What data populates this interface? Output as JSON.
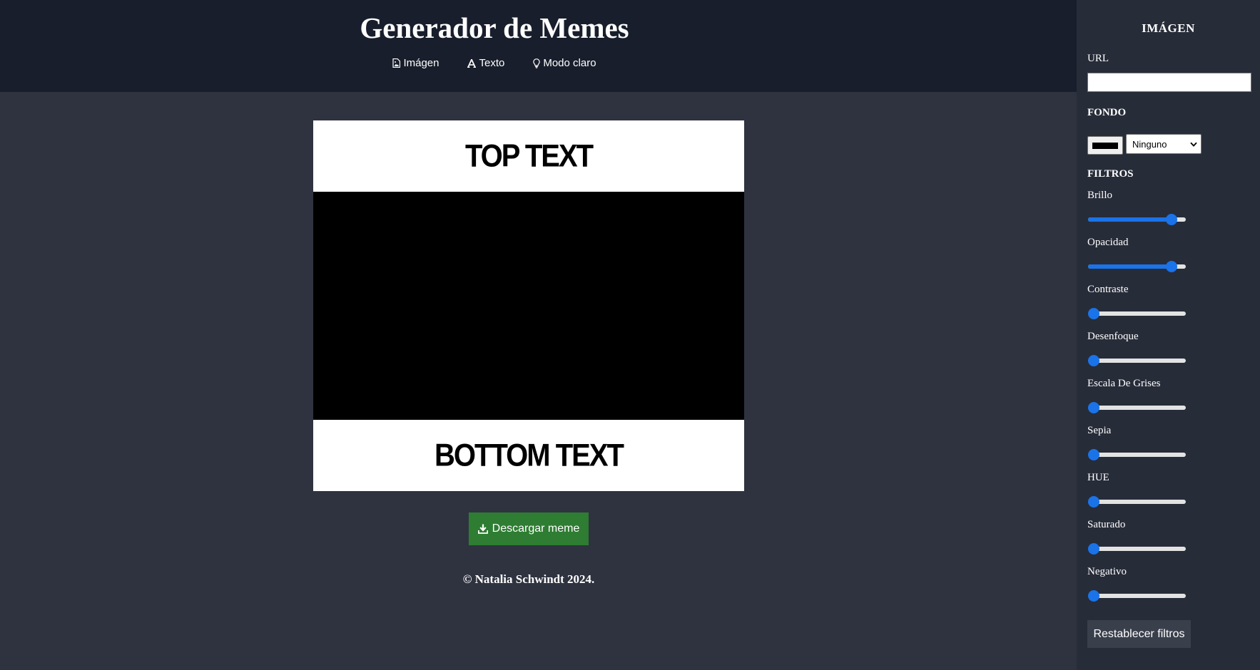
{
  "header": {
    "title": "Generador de Memes",
    "nav": [
      {
        "label": "Imágen",
        "icon": "image-file-icon"
      },
      {
        "label": "Texto",
        "icon": "text-a-icon"
      },
      {
        "label": "Modo claro",
        "icon": "lightbulb-icon"
      }
    ]
  },
  "meme": {
    "top_text": "TOP TEXT",
    "bottom_text": "BOTTOM TEXT"
  },
  "download_label": "Descargar meme",
  "footer": "© Natalia Schwindt 2024.",
  "panel": {
    "title": "IMÁGEN",
    "url_label": "URL",
    "url_value": "",
    "background_label": "FONDO",
    "background_color": "#000000",
    "blend_selected": "Ninguno",
    "filters_label": "FILTROS",
    "filters": [
      {
        "label": "Brillo",
        "value_fraction": 0.9
      },
      {
        "label": "Opacidad",
        "value_fraction": 0.9
      },
      {
        "label": "Contraste",
        "value_fraction": 0.0
      },
      {
        "label": "Desenfoque",
        "value_fraction": 0.0
      },
      {
        "label": "Escala De Grises",
        "value_fraction": 0.0
      },
      {
        "label": "Sepia",
        "value_fraction": 0.0
      },
      {
        "label": "HUE",
        "value_fraction": 0.0
      },
      {
        "label": "Saturado",
        "value_fraction": 0.0
      },
      {
        "label": "Negativo",
        "value_fraction": 0.0
      }
    ],
    "reset_label": "Restablecer filtros"
  },
  "colors": {
    "header_bg": "#181e2b",
    "page_bg": "#2f3340",
    "panel_bg": "#272c39",
    "download_green": "#2e7d32",
    "slider_accent": "#1a73e8"
  }
}
